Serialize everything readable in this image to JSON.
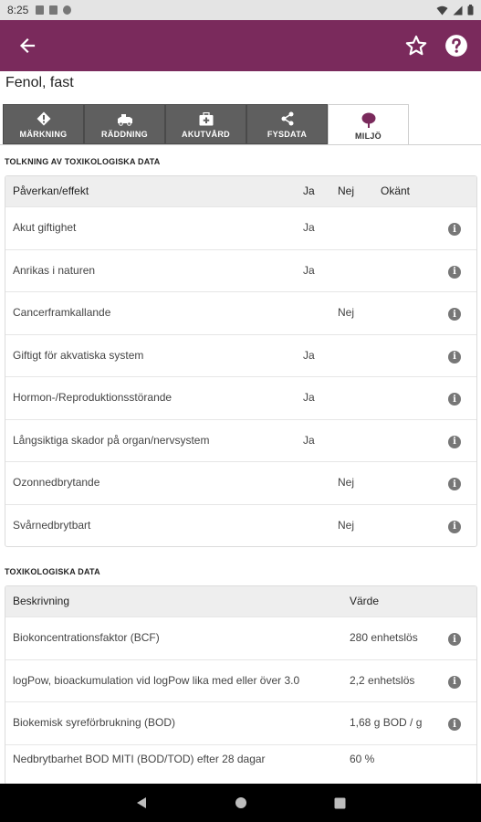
{
  "status_bar": {
    "time": "8:25"
  },
  "app_bar": {
    "accent_color": "#7a2a5c",
    "icons": [
      "back-arrow-icon",
      "star-icon",
      "help-icon"
    ]
  },
  "title": "Fenol, fast",
  "tabs": [
    {
      "label": "MÄRKNING",
      "icon": "warning-diamond-icon"
    },
    {
      "label": "RÄDDNING",
      "icon": "rescue-vehicle-icon"
    },
    {
      "label": "AKUTVÅRD",
      "icon": "medical-kit-icon"
    },
    {
      "label": "FYSDATA",
      "icon": "share-nodes-icon"
    },
    {
      "label": "MILJÖ",
      "icon": "tree-icon",
      "active": true
    }
  ],
  "section1": {
    "title": "TOLKNING AV TOXIKOLOGISKA DATA",
    "headers": {
      "effect": "Påverkan/effekt",
      "yes": "Ja",
      "no": "Nej",
      "unknown": "Okänt"
    },
    "rows": [
      {
        "label": "Akut giftighet",
        "yes": "Ja",
        "no": ""
      },
      {
        "label": "Anrikas i naturen",
        "yes": "Ja",
        "no": ""
      },
      {
        "label": "Cancerframkallande",
        "yes": "",
        "no": "Nej"
      },
      {
        "label": "Giftigt för akvatiska system",
        "yes": "Ja",
        "no": ""
      },
      {
        "label": "Hormon-/Reproduktionsstörande",
        "yes": "Ja",
        "no": ""
      },
      {
        "label": "Långsiktiga skador på organ/nervsystem",
        "yes": "Ja",
        "no": ""
      },
      {
        "label": "Ozonnedbrytande",
        "yes": "",
        "no": "Nej"
      },
      {
        "label": "Svårnedbrytbart",
        "yes": "",
        "no": "Nej"
      }
    ]
  },
  "section2": {
    "title": "TOXIKOLOGISKA DATA",
    "headers": {
      "description": "Beskrivning",
      "value": "Värde"
    },
    "rows": [
      {
        "label": "Biokoncentrationsfaktor (BCF)",
        "value": "280 enhetslös",
        "info": true
      },
      {
        "label": "logPow, bioackumulation vid logPow lika med eller över 3.0",
        "value": "2,2 enhetslös",
        "info": true
      },
      {
        "label": "Biokemisk syreförbrukning (BOD)",
        "value": "1,68 g BOD / g",
        "info": true
      },
      {
        "label": "Nedbrytbarhet BOD MITI (BOD/TOD) efter 28 dagar",
        "value": "60 %",
        "info": false
      }
    ]
  }
}
